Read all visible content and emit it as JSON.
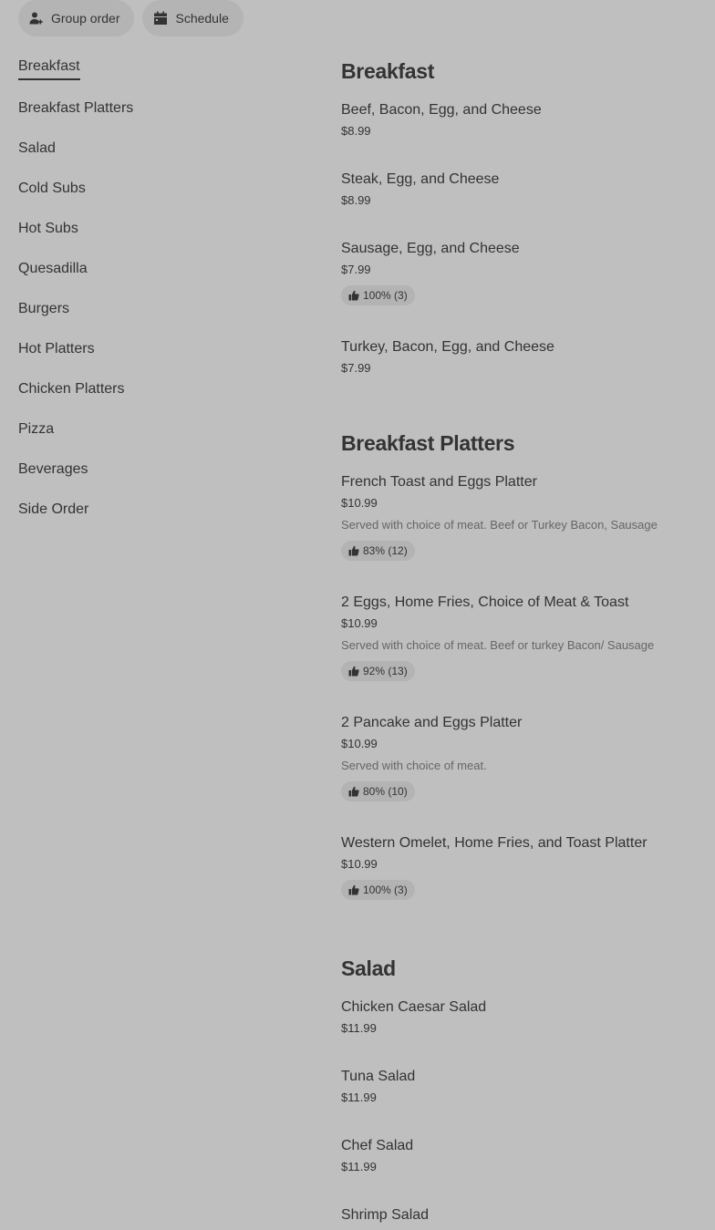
{
  "top_actions": {
    "group_order_label": "Group order",
    "schedule_label": "Schedule"
  },
  "categories": [
    {
      "label": "Breakfast",
      "active": true
    },
    {
      "label": "Breakfast Platters"
    },
    {
      "label": "Salad"
    },
    {
      "label": "Cold Subs"
    },
    {
      "label": "Hot Subs"
    },
    {
      "label": "Quesadilla"
    },
    {
      "label": "Burgers"
    },
    {
      "label": "Hot Platters"
    },
    {
      "label": "Chicken Platters"
    },
    {
      "label": "Pizza"
    },
    {
      "label": "Beverages"
    },
    {
      "label": "Side Order"
    }
  ],
  "sections": [
    {
      "title": "Breakfast",
      "items": [
        {
          "name": "Beef, Bacon, Egg, and Cheese",
          "price": "$8.99"
        },
        {
          "name": "Steak, Egg, and Cheese",
          "price": "$8.99"
        },
        {
          "name": "Sausage, Egg, and Cheese",
          "price": "$7.99",
          "rating": "100% (3)"
        },
        {
          "name": "Turkey, Bacon, Egg, and Cheese",
          "price": "$7.99"
        }
      ]
    },
    {
      "title": "Breakfast Platters",
      "items": [
        {
          "name": "French Toast and Eggs Platter",
          "price": "$10.99",
          "description": "Served with choice of meat. Beef or Turkey Bacon, Sausage",
          "rating": "83% (12)"
        },
        {
          "name": "2 Eggs, Home Fries, Choice of Meat & Toast",
          "price": "$10.99",
          "description": "Served with choice of meat. Beef or turkey Bacon/ Sausage",
          "rating": "92% (13)"
        },
        {
          "name": "2 Pancake and Eggs Platter",
          "price": "$10.99",
          "description": "Served with choice of meat.",
          "rating": "80% (10)"
        },
        {
          "name": "Western Omelet, Home Fries, and Toast Platter",
          "price": "$10.99",
          "rating": "100% (3)"
        }
      ]
    },
    {
      "title": "Salad",
      "items": [
        {
          "name": "Chicken Caesar Salad",
          "price": "$11.99"
        },
        {
          "name": "Tuna Salad",
          "price": "$11.99"
        },
        {
          "name": "Chef Salad",
          "price": "$11.99"
        },
        {
          "name": "Shrimp Salad",
          "price": ""
        }
      ]
    }
  ],
  "icons": {
    "group_order": "person-add-icon",
    "schedule": "calendar-icon",
    "rating": "thumbs-up-icon"
  }
}
